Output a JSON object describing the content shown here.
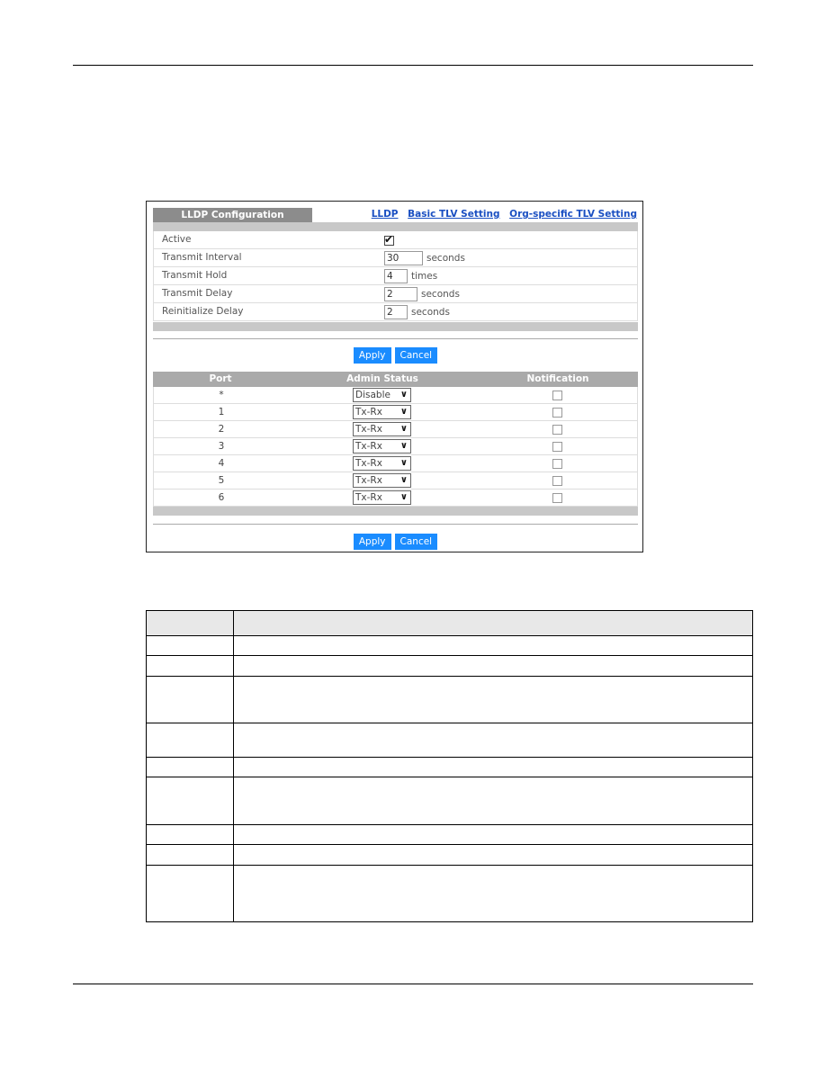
{
  "panel": {
    "title": "LLDP Configuration",
    "links": [
      "LLDP",
      "Basic TLV Setting",
      "Org-specific TLV Setting"
    ]
  },
  "settings": {
    "active": {
      "label": "Active",
      "checked": true
    },
    "transmit_interval": {
      "label": "Transmit Interval",
      "value": "30",
      "unit": "seconds"
    },
    "transmit_hold": {
      "label": "Transmit Hold",
      "value": "4",
      "unit": "times"
    },
    "transmit_delay": {
      "label": "Transmit Delay",
      "value": "2",
      "unit": "seconds"
    },
    "reinitialize_delay": {
      "label": "Reinitialize Delay",
      "value": "2",
      "unit": "seconds"
    }
  },
  "buttons": {
    "apply": "Apply",
    "cancel": "Cancel"
  },
  "port_table": {
    "headers": {
      "port": "Port",
      "admin_status": "Admin Status",
      "notification": "Notification"
    },
    "rows": [
      {
        "port": "*",
        "admin_status": "Disable",
        "notification": false
      },
      {
        "port": "1",
        "admin_status": "Tx-Rx",
        "notification": false
      },
      {
        "port": "2",
        "admin_status": "Tx-Rx",
        "notification": false
      },
      {
        "port": "3",
        "admin_status": "Tx-Rx",
        "notification": false
      },
      {
        "port": "4",
        "admin_status": "Tx-Rx",
        "notification": false
      },
      {
        "port": "5",
        "admin_status": "Tx-Rx",
        "notification": false
      },
      {
        "port": "6",
        "admin_status": "Tx-Rx",
        "notification": false
      }
    ]
  },
  "colors": {
    "button": "#1a8cff",
    "link": "#1a4fc2",
    "tab": "#8c8c8c",
    "table_head": "#aaaaaa"
  }
}
